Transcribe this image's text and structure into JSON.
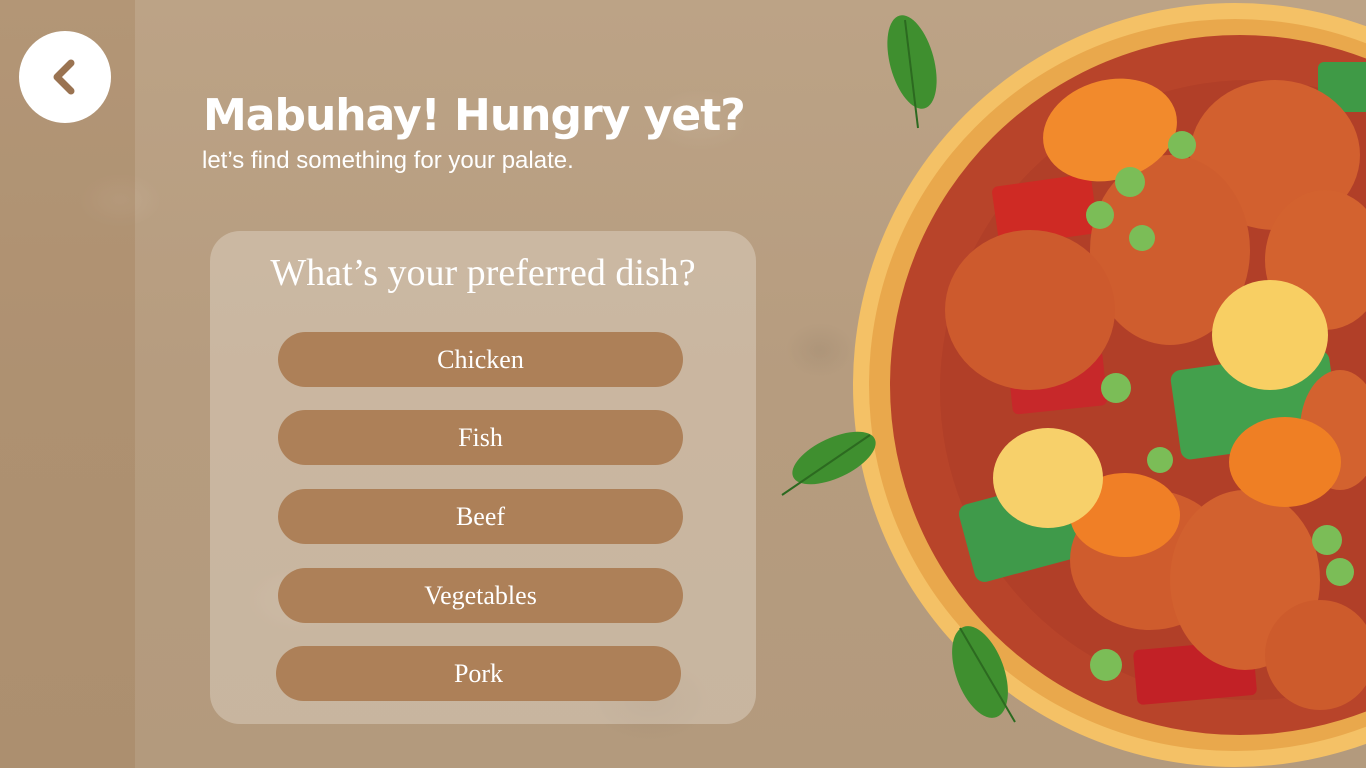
{
  "header": {
    "title": "Mabuhay! Hungry yet?",
    "subtitle": "let’s find something for your palate."
  },
  "back_button": {
    "icon": "chevron-left-icon"
  },
  "quiz": {
    "question": "What’s your preferred dish?",
    "options": [
      {
        "label": "Chicken"
      },
      {
        "label": "Fish"
      },
      {
        "label": "Beef"
      },
      {
        "label": "Vegetables"
      },
      {
        "label": "Pork"
      }
    ]
  },
  "colors": {
    "background": "#b79d80",
    "option_button": "#ad8058",
    "text": "#ffffff",
    "dish_sauce": "#b8442a",
    "plate_rim": "#f4c166"
  }
}
